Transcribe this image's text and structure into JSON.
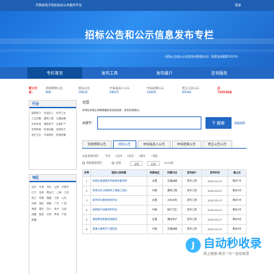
{
  "top": {
    "site": "河南省电子招标投标公共服务平台",
    "login": "登录"
  },
  "banner": {
    "title": "招标公告和公示信息发布专栏",
    "subtitle": "《招标公告和公示信息发布管理办法》（国家发改委第10号令）"
  },
  "nav": [
    "专栏首页",
    "发布工具",
    "发布媒介",
    "咨询服务"
  ],
  "stats": [
    {
      "label": "累计交易：",
      "value": "",
      "red": true
    },
    {
      "label": "资格预审公告",
      "value": "988"
    },
    {
      "label": "招标公告",
      "value": "29628"
    },
    {
      "label": "中标候选人公示",
      "value": "99025"
    },
    {
      "label": "中标结果公示",
      "value": "24689"
    },
    {
      "label": "更正公告公示",
      "value": "85046"
    },
    {
      "label": "总",
      "value": "728548条",
      "red": true
    }
  ],
  "sidebar": {
    "industry": {
      "title": "行业",
      "items": [
        "能源电力",
        "石油化工",
        "化学工业",
        "工业设备",
        "建筑工程",
        "交通运输",
        "水利水电",
        "通信电子",
        "冶金矿产",
        "农林牧渔",
        "机电设备",
        "信息电子",
        "医疗卫生",
        "环保绿化",
        "机械设备"
      ]
    },
    "region": {
      "title": "地区",
      "items": [
        "北京",
        "天津",
        "河北",
        "山西",
        "内蒙古",
        "辽宁",
        "吉林",
        "黑龙江",
        "上海",
        "江苏",
        "浙江",
        "安徽",
        "福建",
        "江西",
        "山东",
        "河南",
        "湖北",
        "湖南",
        "广东",
        "广西",
        "海南",
        "重庆",
        "四川",
        "贵州",
        "云南",
        "西藏",
        "陕西",
        "甘肃",
        "青海",
        "宁夏",
        "新疆"
      ]
    }
  },
  "main": {
    "region": "全国",
    "notice": "本项目申报主体需具备相关招标资质，发布前请核实；",
    "search_label": "关键字：",
    "search_placeholder": "",
    "search_button": "搜索",
    "advanced": "高级搜索",
    "tabs": [
      "资格预审公告",
      "招标公告",
      "中标候选人公示",
      "中标结果公示",
      "更正公告公示"
    ],
    "active_tab": 1,
    "filter_time_label": "公告发布时间：",
    "filter_times": [
      "今天",
      "2天内",
      "3天内",
      "1周内",
      "一周后"
    ],
    "filter_radio": [
      "所有招标项目",
      "全部",
      "全国",
      "全部"
    ],
    "filter_count": "2016条",
    "table_headers": [
      "序号",
      "招标公告标题",
      "所属地区",
      "所属行业",
      "发布媒介",
      "发布时间",
      "截止日"
    ],
    "rows": [
      {
        "no": "1",
        "title": "地铁区域道路专项维修设备采购",
        "region": "全国",
        "industry": "交通运输",
        "media": "发布工具",
        "date": "2020-02-07",
        "end": "剩余7天"
      },
      {
        "no": "2",
        "title": "某单位办公楼维修工程施工招标",
        "region": "河南",
        "industry": "建筑工程",
        "media": "发布工具",
        "date": "2020-02-07",
        "end": "剩余3天"
      },
      {
        "no": "3",
        "title": "城市供水管网改造项目",
        "region": "全国",
        "industry": "水利水电",
        "media": "发布工具",
        "date": "2020-02-07",
        "end": "剩余5天"
      },
      {
        "no": "4",
        "title": "医院医疗设备采购项目",
        "region": "河南",
        "industry": "医疗卫生",
        "media": "发布工具",
        "date": "2020-02-07",
        "end": "剩余5天"
      },
      {
        "no": "5",
        "title": "通信基站配套设施建设",
        "region": "全国",
        "industry": "通信电子",
        "media": "发布工具",
        "date": "2020-02-07",
        "end": "剩余6天"
      },
      {
        "no": "6",
        "title": "高速公路养护工程招标",
        "region": "河南",
        "industry": "交通运输",
        "media": "发布工具",
        "date": "2020-02-07",
        "end": "剩余8天"
      }
    ]
  },
  "watermark": {
    "brand": "自动秒收录",
    "tagline": "网上链接·来访一次一自动收录"
  }
}
